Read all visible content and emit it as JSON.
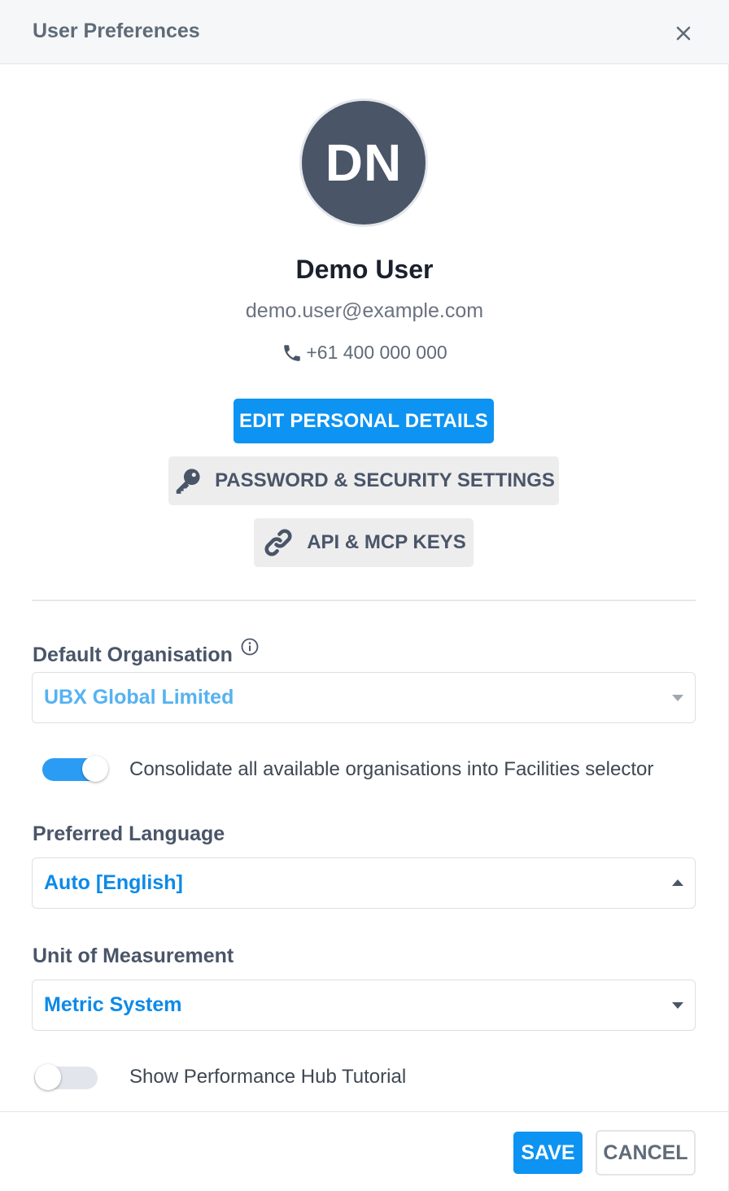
{
  "header": {
    "title": "User Preferences",
    "close_icon": "close-icon"
  },
  "profile": {
    "initials": "DN",
    "name": "Demo User",
    "email": "demo.user@example.com",
    "phone": "+61 400 000 000"
  },
  "actions": {
    "edit_personal_details": "EDIT PERSONAL DETAILS",
    "password_security": "PASSWORD & SECURITY SETTINGS",
    "api_keys": "API & MCP KEYS"
  },
  "default_organisation": {
    "label": "Default Organisation",
    "value": "UBX Global Limited",
    "info_icon": "info-icon"
  },
  "consolidate_toggle": {
    "label": "Consolidate all available organisations into Facilities selector",
    "on": true
  },
  "preferred_language": {
    "label": "Preferred Language",
    "value": "Auto [English]",
    "expanded": true
  },
  "unit_of_measurement": {
    "label": "Unit of Measurement",
    "value": "Metric System"
  },
  "tutorial_toggle": {
    "label": "Show Performance Hub Tutorial",
    "on": false
  },
  "footer": {
    "save": "SAVE",
    "cancel": "CANCEL"
  },
  "colors": {
    "primary": "#0d93f2",
    "avatar_bg": "#4a5568",
    "muted_value": "#55b2f2",
    "toggle_on": "#2b9cf4",
    "toggle_off": "#e2e6ec"
  }
}
